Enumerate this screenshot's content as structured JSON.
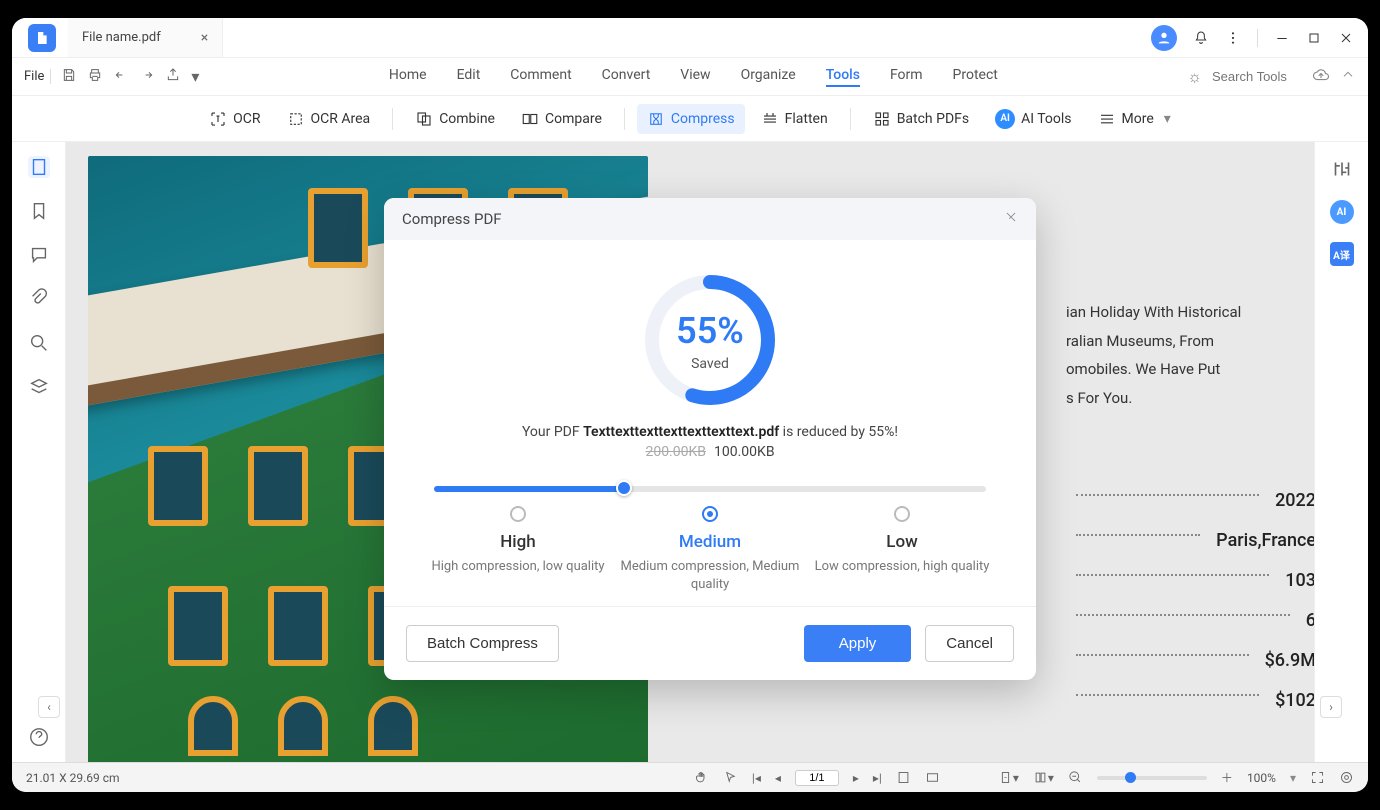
{
  "titlebar": {
    "filename": "File name.pdf"
  },
  "menu": {
    "file": "File",
    "items": [
      "Home",
      "Edit",
      "Comment",
      "Convert",
      "View",
      "Organize",
      "Tools",
      "Form",
      "Protect"
    ],
    "active_index": 6,
    "search_placeholder": "Search Tools"
  },
  "toolbar": {
    "ocr": "OCR",
    "ocr_area": "OCR Area",
    "combine": "Combine",
    "compare": "Compare",
    "compress": "Compress",
    "flatten": "Flatten",
    "batch": "Batch PDFs",
    "ai": "AI Tools",
    "more": "More"
  },
  "document": {
    "text_lines": [
      "ian Holiday With Historical",
      "ralian Museums, From",
      "omobiles. We Have Put",
      "s For You."
    ],
    "data": [
      {
        "value": "2022"
      },
      {
        "value": "Paris,France"
      },
      {
        "value": "103"
      },
      {
        "value": "6"
      },
      {
        "value": "$6.9M"
      },
      {
        "value": "$102"
      }
    ]
  },
  "status": {
    "dimensions": "21.01 X 29.69 cm",
    "page": "1/1",
    "zoom": "100%"
  },
  "modal": {
    "title": "Compress PDF",
    "percent": "55%",
    "saved_label": "Saved",
    "line_prefix": "Your PDF ",
    "filename": "Texttexttexttexttexttexttext.pdf",
    "line_suffix": " is reduced by 55%!",
    "old_size": "200.00KB",
    "new_size": "100.00KB",
    "options": [
      {
        "title": "High",
        "desc": "High compression,\nlow quality"
      },
      {
        "title": "Medium",
        "desc": "Medium compression,\nMedium quality"
      },
      {
        "title": "Low",
        "desc": "Low compression,\nhigh quality"
      }
    ],
    "selected_option": 1,
    "batch_btn": "Batch Compress",
    "apply_btn": "Apply",
    "cancel_btn": "Cancel"
  }
}
